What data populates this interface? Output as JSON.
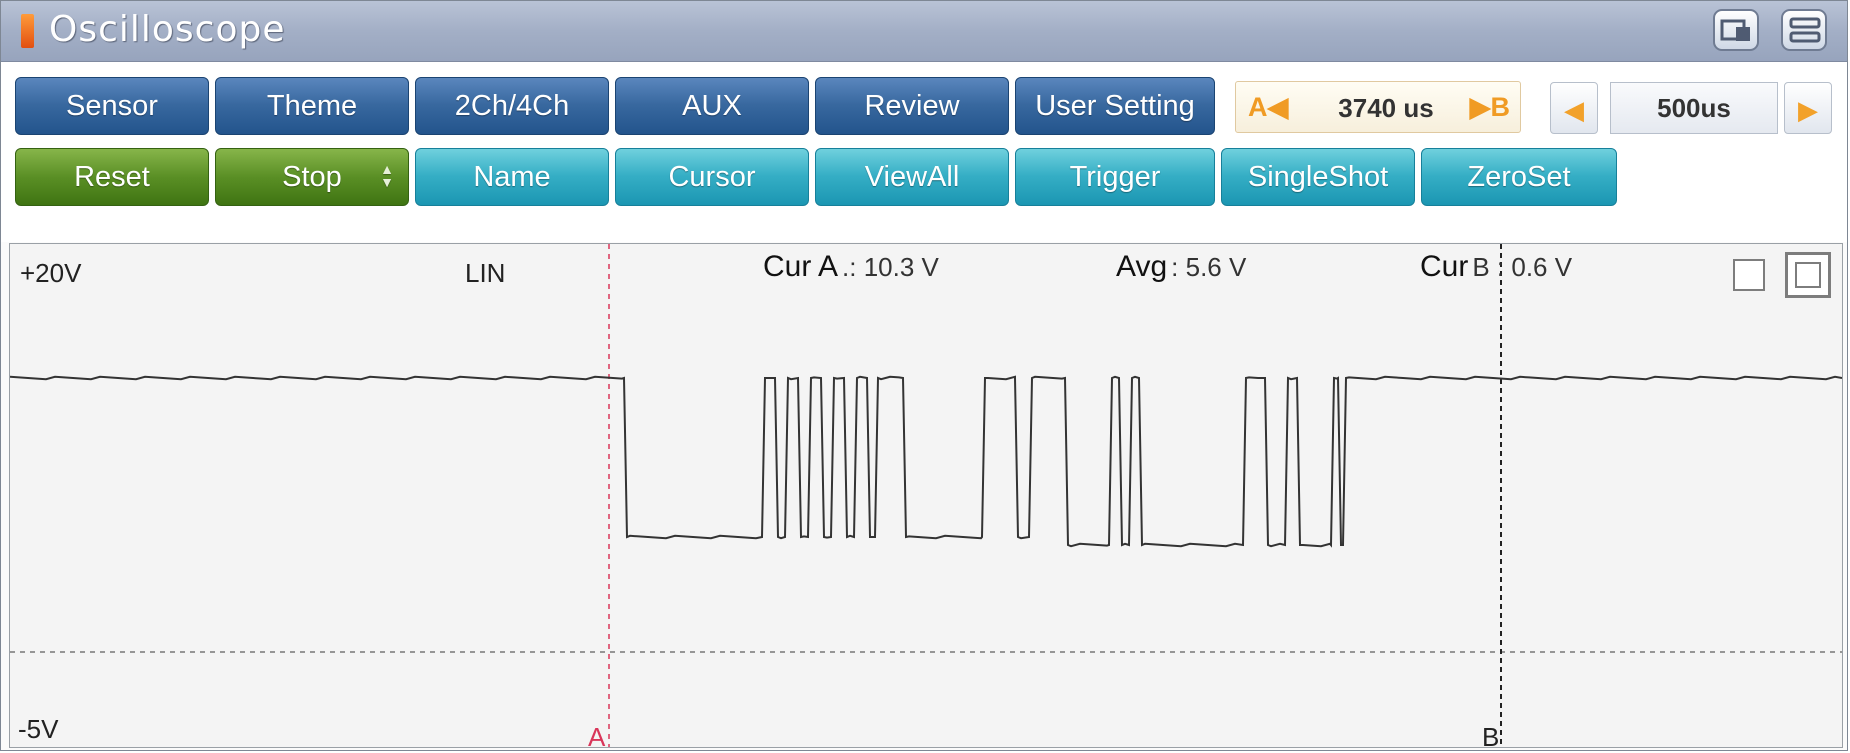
{
  "window": {
    "title": "Oscilloscope",
    "icons": [
      "window-mode-icon",
      "menu-list-icon"
    ]
  },
  "toolbar": {
    "row1": [
      "Sensor",
      "Theme",
      "2Ch/4Ch",
      "AUX",
      "Review",
      "User Setting"
    ],
    "row2": [
      "Reset",
      "Stop",
      "Name",
      "Cursor",
      "ViewAll",
      "Trigger",
      "SingleShot",
      "ZeroSet"
    ],
    "cursor_span": {
      "a_label": "A",
      "b_label": "B",
      "value": "3740 us"
    },
    "timebase": {
      "value": "500us"
    }
  },
  "plot": {
    "y_top_label": "+20V",
    "y_bottom_label": "-5V",
    "channel_label": "LIN",
    "readouts": [
      {
        "name": "Cur A",
        "value": ".: 10.3 V"
      },
      {
        "name": "Avg",
        "value": ": 5.6 V"
      },
      {
        "name": "Cur",
        "value": "B : 0.6 V"
      }
    ],
    "cursor_a_marker": "A",
    "cursor_b_marker": "B",
    "colors": {
      "trace": "#333333",
      "cursor_a": "#d9365a",
      "cursor_b": "#222222",
      "background": "#f4f4f4"
    }
  }
}
